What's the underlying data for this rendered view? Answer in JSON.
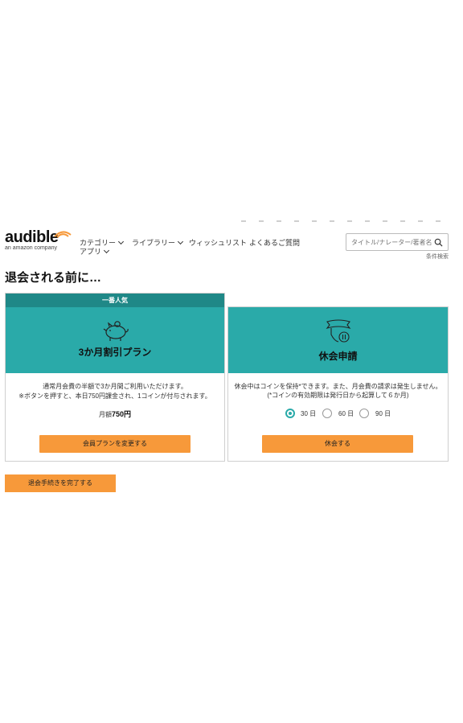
{
  "brand": {
    "name": "audible",
    "tagline": "an amazon company"
  },
  "nav": {
    "categories": "カテゴリー",
    "library": "ライブラリー",
    "wishlist": "ウィッシュリスト",
    "faq": "よくあるご質問",
    "app": "アプリ"
  },
  "search": {
    "placeholder": "タイトル/ナレーター/著者名で",
    "advanced": "条件検索"
  },
  "page": {
    "title": "退会される前に…"
  },
  "discount_card": {
    "badge": "一番人気",
    "title": "3か月割引プラン",
    "desc_line1": "通常月会費の半額で3か月間ご利用いただけます。",
    "desc_line2": "※ボタンを押すと、本日750円課金され、1コインが付与されます。",
    "price_prefix": "月額",
    "price_value": "750円",
    "button": "会員プランを変更する"
  },
  "pause_card": {
    "title": "休会申請",
    "desc_line1": "休会中はコインを保持*できます。また、月会費の請求は発生しません。",
    "desc_line2": "(*コインの有効期限は発行日から起算して６か月)",
    "options": [
      {
        "label": "30 日",
        "selected": true
      },
      {
        "label": "60 日",
        "selected": false
      },
      {
        "label": "90 日",
        "selected": false
      }
    ],
    "button": "休会する"
  },
  "finish_button": "退会手続きを完了する",
  "colors": {
    "teal": "#2aaaa9",
    "teal_dark": "#1f8887",
    "orange": "#f7993a"
  }
}
